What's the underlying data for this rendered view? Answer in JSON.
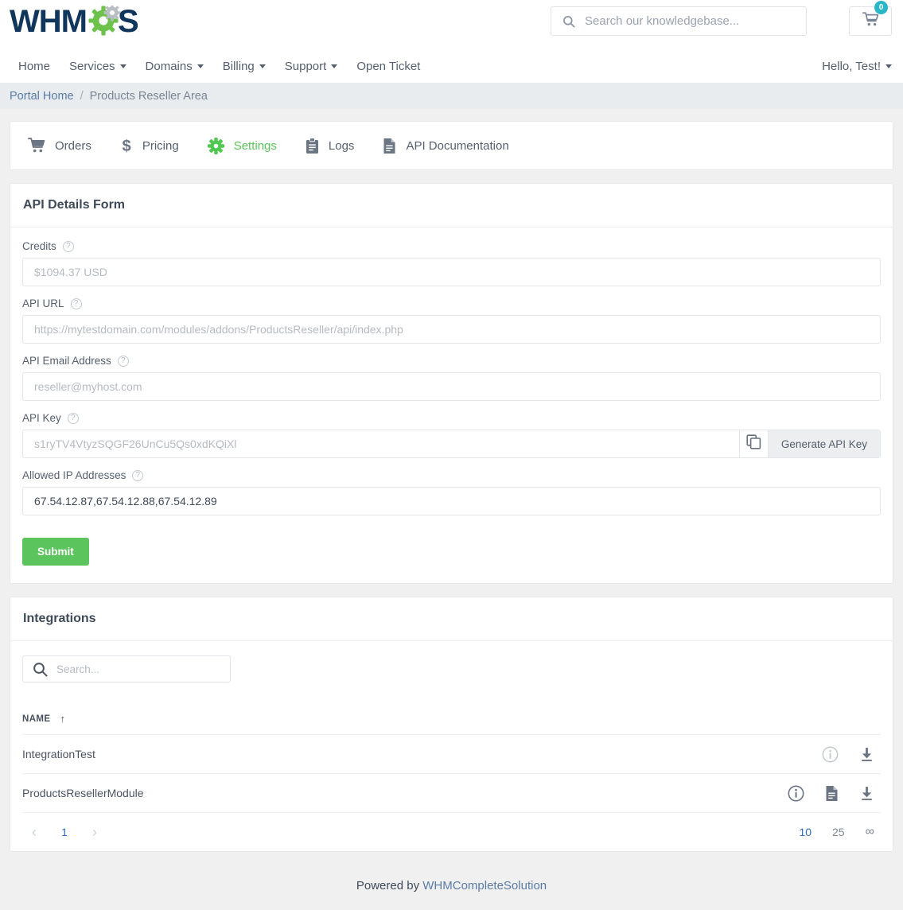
{
  "header": {
    "logo_text": "WHMCS",
    "search": {
      "placeholder": "Search our knowledgebase...",
      "value": "",
      "icon": "search-icon"
    },
    "cart": {
      "icon": "shopping-cart-icon",
      "count": "0"
    }
  },
  "nav": {
    "items": [
      {
        "label": "Home",
        "caret": false
      },
      {
        "label": "Services",
        "caret": true
      },
      {
        "label": "Domains",
        "caret": true
      },
      {
        "label": "Billing",
        "caret": true
      },
      {
        "label": "Support",
        "caret": true
      },
      {
        "label": "Open Ticket",
        "caret": false
      }
    ],
    "account": {
      "label": "Hello, Test!",
      "caret": true
    }
  },
  "breadcrumb": {
    "home": "Portal Home",
    "separator": "/",
    "current": "Products Reseller Area"
  },
  "tabs": [
    {
      "label": "Orders",
      "icon": "shopping-cart-icon",
      "active": false
    },
    {
      "label": "Pricing",
      "icon": "dollar-sign-icon",
      "active": false
    },
    {
      "label": "Settings",
      "icon": "gear-icon",
      "active": true
    },
    {
      "label": "Logs",
      "icon": "clipboard-icon",
      "active": false
    },
    {
      "label": "API Documentation",
      "icon": "document-icon",
      "active": false
    }
  ],
  "api_form": {
    "title": "API Details Form",
    "fields": {
      "credits": {
        "label": "Credits",
        "placeholder": "$1094.37 USD",
        "value": ""
      },
      "api_url": {
        "label": "API URL",
        "placeholder": "https://mytestdomain.com/modules/addons/ProductsReseller/api/index.php",
        "value": ""
      },
      "api_email": {
        "label": "API Email Address",
        "placeholder": "reseller@myhost.com",
        "value": ""
      },
      "api_key": {
        "label": "API Key",
        "placeholder": "s1ryTV4VtyzSQGF26UnCu5Qs0xdKQiXl",
        "value": ""
      },
      "allowed_ips": {
        "label": "Allowed IP Addresses",
        "placeholder": "",
        "value": "67.54.12.87,67.54.12.88,67.54.12.89"
      }
    },
    "copy_icon": "copy-icon",
    "generate_label": "Generate API Key",
    "submit_label": "Submit"
  },
  "integrations": {
    "title": "Integrations",
    "search": {
      "placeholder": "Search...",
      "value": "",
      "icon": "search-icon"
    },
    "columns": [
      "NAME"
    ],
    "sort_indicator": "↑",
    "rows": [
      {
        "name": "IntegrationTest",
        "actions": [
          "info-icon",
          "download-icon"
        ]
      },
      {
        "name": "ProductsResellerModule",
        "actions": [
          "info-icon",
          "document-icon",
          "download-icon"
        ]
      }
    ],
    "pagination": {
      "prev": "‹",
      "next": "›",
      "pages": [
        "1"
      ],
      "current_page": "1",
      "page_sizes": [
        "10",
        "25",
        "∞"
      ],
      "active_size": "10"
    }
  },
  "footer": {
    "prefix": "Powered by ",
    "link": "WHMCompleteSolution"
  },
  "colors": {
    "accent_green": "#5cc45c",
    "link_blue": "#5a7ba6",
    "page_bg": "#f0f0f0",
    "breadcrumb_bg": "#e8ecef",
    "badge_teal": "#29b6c8",
    "logo_navy": "#10365c"
  }
}
